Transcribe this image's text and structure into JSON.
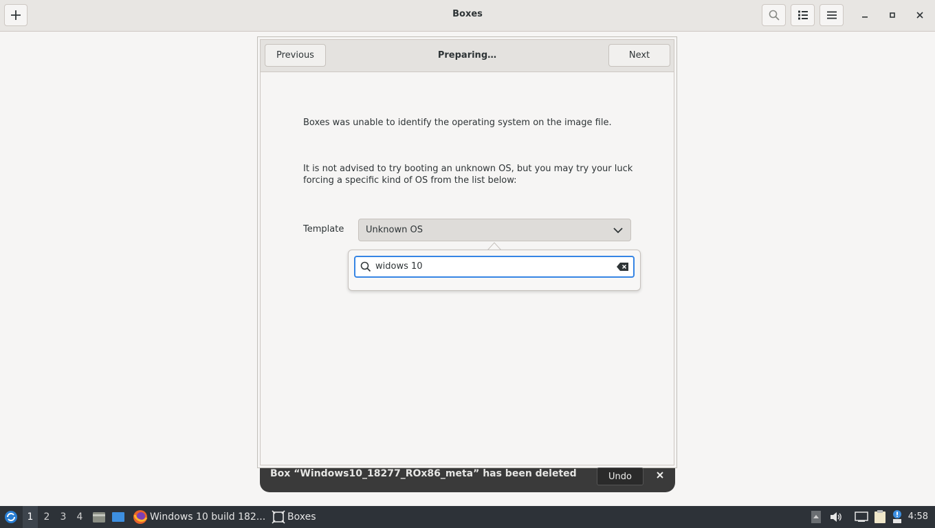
{
  "window": {
    "title": "Boxes"
  },
  "dialog": {
    "title": "Preparing…",
    "previous_label": "Previous",
    "next_label": "Next",
    "message_1": "Boxes was unable to identify the operating system on the image file.",
    "message_2_line1": "It is not advised to try booting an unknown OS, but you may try your luck",
    "message_2_line2": "forcing a specific kind of OS from the list below:",
    "template_label": "Template",
    "template_value": "Unknown OS"
  },
  "popover": {
    "search_value": "widows 10"
  },
  "notification": {
    "text": "Box “Windows10_18277_ROx86_meta” has been deleted",
    "undo_label": "Undo"
  },
  "taskbar": {
    "workspaces": [
      "1",
      "2",
      "3",
      "4"
    ],
    "active_workspace": "1",
    "firefox_task": "Windows 10 build 182...",
    "boxes_task": "Boxes",
    "clock": "4:58"
  },
  "colors": {
    "accent": "#3584e4",
    "headerbar": "#e8e6e3",
    "taskbar": "#2d3238",
    "notification": "#3a3a3a"
  }
}
